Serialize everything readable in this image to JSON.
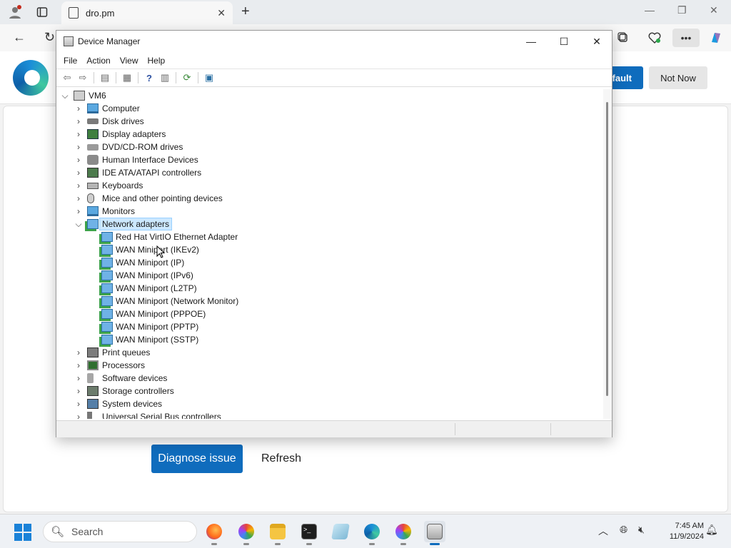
{
  "browser": {
    "tab_title": "dro.pm",
    "new_tab_glyph": "+",
    "window_controls": [
      "—",
      "❐",
      "✕"
    ]
  },
  "infobar": {
    "default_button_label": "efault",
    "not_now_label": "Not Now"
  },
  "page": {
    "diagnose_label": "Diagnose issue",
    "refresh_label": "Refresh"
  },
  "device_manager": {
    "title": "Device Manager",
    "menu": [
      "File",
      "Action",
      "View",
      "Help"
    ],
    "root": "VM6",
    "categories": [
      {
        "label": "Computer",
        "icon": "computer-icon",
        "expanded": false
      },
      {
        "label": "Disk drives",
        "icon": "disk-drive-icon",
        "expanded": false
      },
      {
        "label": "Display adapters",
        "icon": "display-adapter-icon",
        "expanded": false
      },
      {
        "label": "DVD/CD-ROM drives",
        "icon": "dvd-drive-icon",
        "expanded": false
      },
      {
        "label": "Human Interface Devices",
        "icon": "hid-icon",
        "expanded": false
      },
      {
        "label": "IDE ATA/ATAPI controllers",
        "icon": "ide-controller-icon",
        "expanded": false
      },
      {
        "label": "Keyboards",
        "icon": "keyboard-icon",
        "expanded": false
      },
      {
        "label": "Mice and other pointing devices",
        "icon": "mouse-icon",
        "expanded": false
      },
      {
        "label": "Monitors",
        "icon": "monitor-icon",
        "expanded": false
      },
      {
        "label": "Network adapters",
        "icon": "network-adapter-icon",
        "expanded": true,
        "selected": true,
        "children": [
          "Red Hat VirtIO Ethernet Adapter",
          "WAN Miniport (IKEv2)",
          "WAN Miniport (IP)",
          "WAN Miniport (IPv6)",
          "WAN Miniport (L2TP)",
          "WAN Miniport (Network Monitor)",
          "WAN Miniport (PPPOE)",
          "WAN Miniport (PPTP)",
          "WAN Miniport (SSTP)"
        ]
      },
      {
        "label": "Print queues",
        "icon": "printer-icon",
        "expanded": false
      },
      {
        "label": "Processors",
        "icon": "processor-icon",
        "expanded": false
      },
      {
        "label": "Software devices",
        "icon": "software-device-icon",
        "expanded": false
      },
      {
        "label": "Storage controllers",
        "icon": "storage-controller-icon",
        "expanded": false
      },
      {
        "label": "System devices",
        "icon": "system-device-icon",
        "expanded": false
      },
      {
        "label": "Universal Serial Bus controllers",
        "icon": "usb-icon",
        "expanded": false
      }
    ]
  },
  "taskbar": {
    "search_placeholder": "Search",
    "time": "7:45 AM",
    "date": "11/9/2024"
  },
  "colors": {
    "accent": "#0f6cbd",
    "selection": "#cce8ff"
  }
}
